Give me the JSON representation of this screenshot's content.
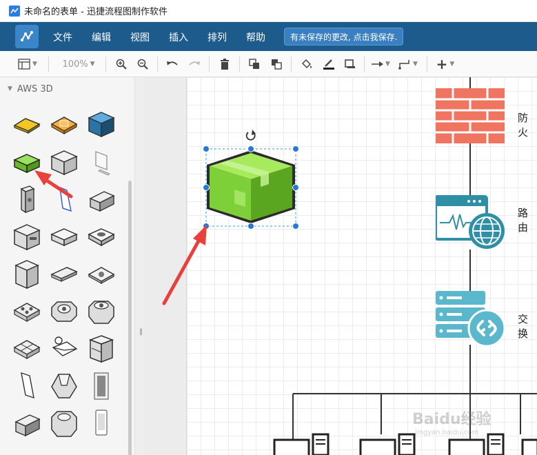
{
  "window": {
    "title": "未命名的表单 - 迅捷流程图制作软件"
  },
  "menubar": {
    "items": [
      "文件",
      "编辑",
      "视图",
      "插入",
      "排列",
      "帮助"
    ],
    "unsaved_notice": "有未保存的更改, 点击我保存."
  },
  "toolbar": {
    "zoom": "100%"
  },
  "sidebar": {
    "section_title": "AWS 3D"
  },
  "canvas": {
    "nodes": [
      {
        "label": "防火",
        "icon": "firewall-icon"
      },
      {
        "label": "路由",
        "icon": "router-icon"
      },
      {
        "label": "交换",
        "icon": "switch-icon"
      }
    ],
    "selected_shape": "green-package-icon"
  },
  "watermark": {
    "text": "Baidu经验",
    "sub": "jingyan.baidu.com"
  },
  "colors": {
    "menubar_bg": "#1d5b8c",
    "accent": "#2d7be5",
    "firewall": "#f07560",
    "teal_icon": "#2f8fa5",
    "selected_green": "#7ed321",
    "annotation_arrow": "#e8403a"
  }
}
